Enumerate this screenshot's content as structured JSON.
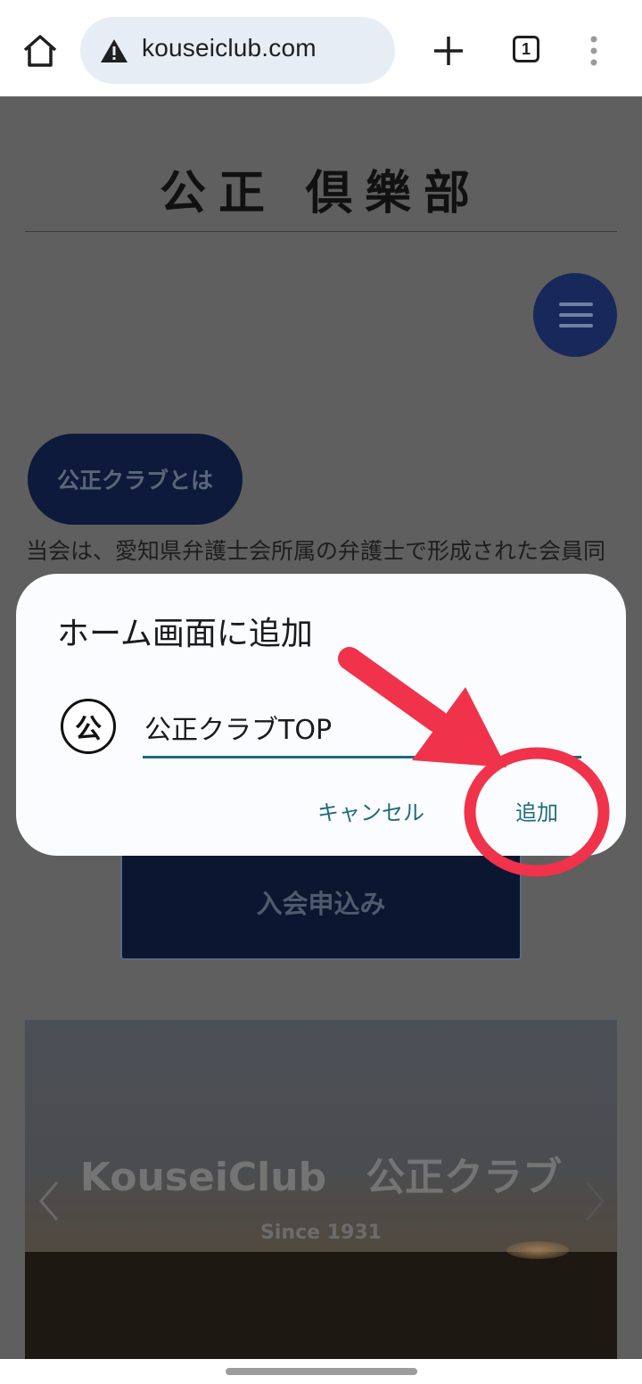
{
  "browser": {
    "url": "kouseiclub.com",
    "tab_count": "1",
    "icons": [
      "home-icon",
      "warning-icon",
      "plus-icon",
      "tabs-icon",
      "more-vert-icon"
    ]
  },
  "page": {
    "site_title": "公正 倶樂部",
    "menu_icon": "hamburger-icon",
    "about_button": "公正クラブとは",
    "intro_text": "当会は、愛知県弁護士会所属の弁護士で形成された会員同",
    "join_button": "入会申込み",
    "hero": {
      "title": "KouseiClub　公正クラブ",
      "subtitle": "Since 1931"
    }
  },
  "dialog": {
    "title": "ホーム画面に追加",
    "icon_glyph": "公",
    "name_value": "公正クラブTOP",
    "cancel_label": "キャンセル",
    "add_label": "追加"
  },
  "colors": {
    "accent": "#1d6b7e",
    "annotation": "#f0334a",
    "navy": "#17295a"
  }
}
